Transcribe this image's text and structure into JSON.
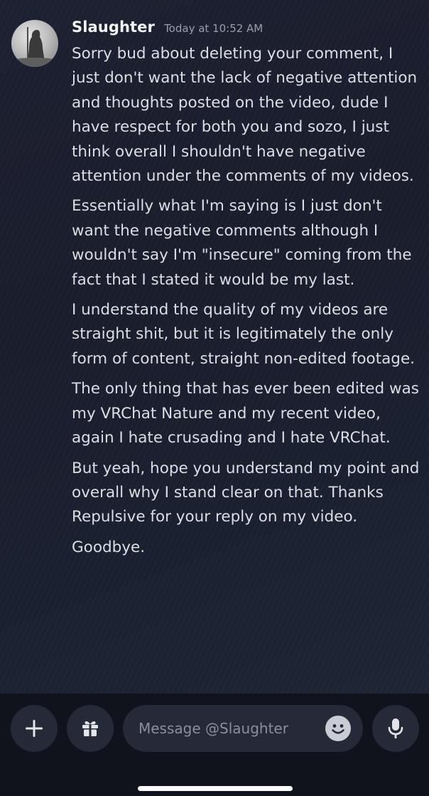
{
  "message": {
    "author": "Slaughter",
    "timestamp": "Today at 10:52 AM",
    "paragraphs": [
      "Sorry bud about deleting your comment, I just don't want the lack of negative attention and thoughts posted on the video, dude I have respect for both you and sozo, I just think overall I shouldn't have negative attention under the comments of my videos.",
      "Essentially what I'm saying is I just don't want the negative comments although I wouldn't say I'm \"insecure\" coming from the fact that I stated it would be my last.",
      "I understand the quality of my videos are straight shit, but it is legitimately the only form of content, straight non-edited footage.",
      "The only thing that has ever been edited was my VRChat Nature and my recent video, again I hate crusading and I hate VRChat.",
      "But yeah, hope you understand my point and overall why I stand clear on that. Thanks Repulsive for your reply on my video.",
      "Goodbye."
    ]
  },
  "composer": {
    "placeholder": "Message @Slaughter",
    "icons": [
      "plus-icon",
      "gift-icon",
      "emoji-icon",
      "microphone-icon"
    ]
  },
  "colors": {
    "background": "#1a1c2a",
    "composer_bg": "#11131c",
    "button_bg": "#262937",
    "text": "#dcdee6",
    "muted": "#9a9eab"
  }
}
